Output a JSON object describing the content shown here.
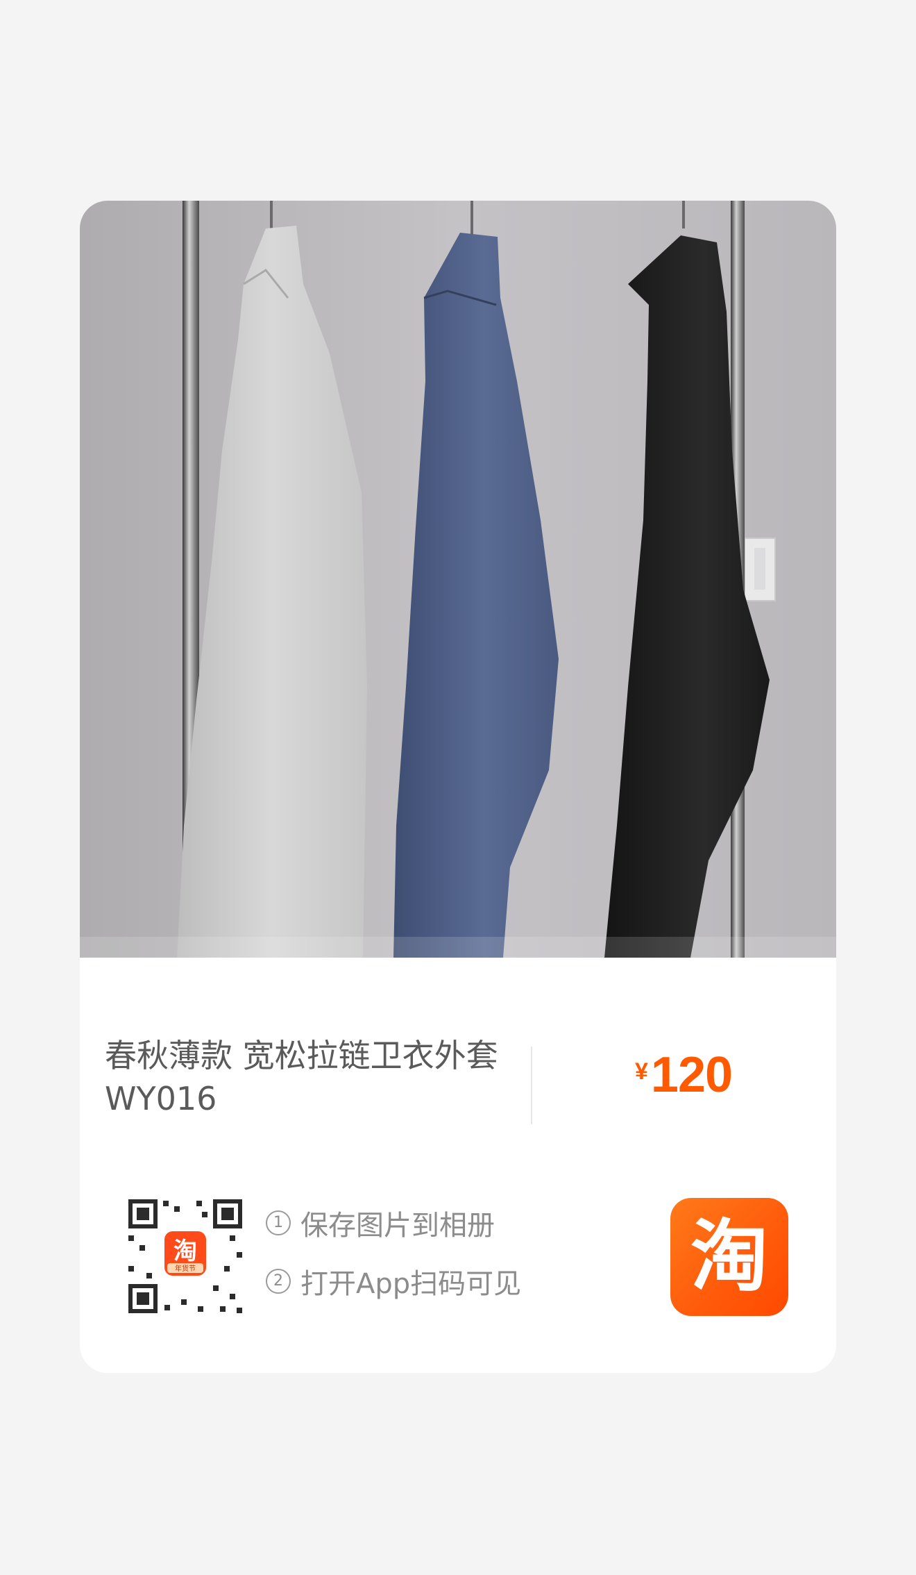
{
  "product": {
    "title": "春秋薄款 宽松拉链卫衣外套 WY016",
    "currency_symbol": "¥",
    "price": "120"
  },
  "share": {
    "qr_badge_text": "淘",
    "qr_badge_sub": "年货节",
    "steps": [
      {
        "number": "1",
        "text": "保存图片到相册"
      },
      {
        "number": "2",
        "text": "打开App扫码可见"
      }
    ]
  },
  "logo": {
    "glyph": "淘"
  },
  "colors": {
    "price": "#ff5a00",
    "logo_bg": "#ff5a0a",
    "page_bg": "#f4f4f4"
  },
  "icons": [
    "taobao-logo-icon",
    "qr-code-icon",
    "step-number-icon"
  ]
}
